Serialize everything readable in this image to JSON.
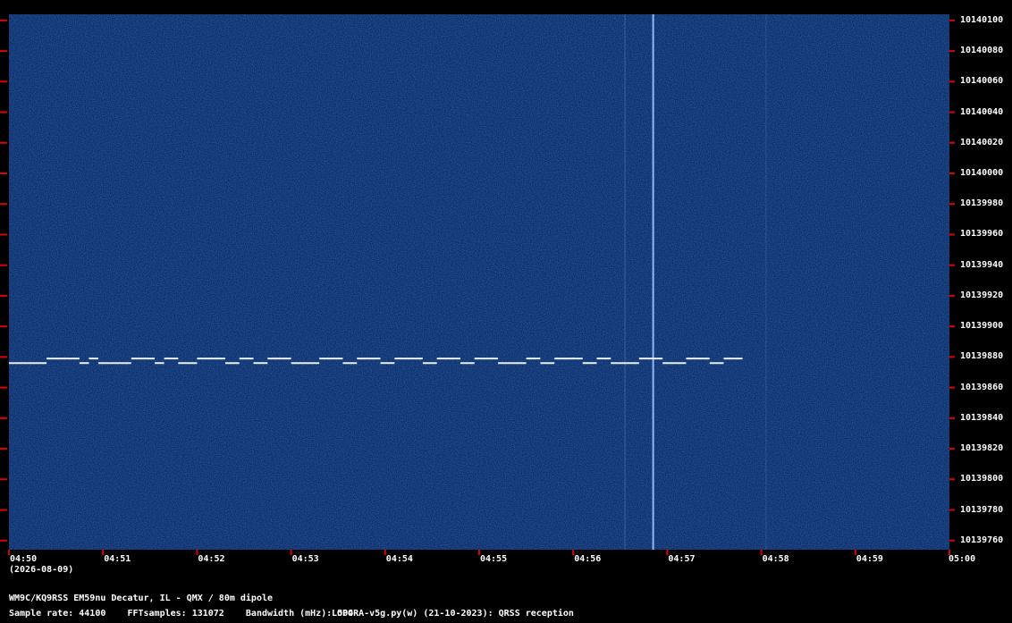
{
  "footer": {
    "date": "(2026-08-09)",
    "station": "WM9C/KQ9RSS EM59nu Decatur, IL - QMX / 80m dipole",
    "sample_info": "Sample rate: 44100    FFTsamples: 131072    Bandwidth (mHz): 504",
    "software": "LOPORA-v5g.py(w) (21-10-2023): QRSS reception"
  },
  "colors": {
    "background": "#000000",
    "plot": "#0a2766",
    "tick": "#e00000",
    "signal": "#e8f0ff"
  },
  "chart_data": {
    "type": "heatmap",
    "title": "",
    "xlabel": "",
    "ylabel": "",
    "x_ticks": [
      "04:50",
      "04:51",
      "04:52",
      "04:53",
      "04:54",
      "04:55",
      "04:56",
      "04:57",
      "04:58",
      "04:59",
      "05:00"
    ],
    "y_ticks": [
      "10140100",
      "10140080",
      "10140060",
      "10140040",
      "10140020",
      "10140000",
      "10139980",
      "10139960",
      "10139940",
      "10139920",
      "10139900",
      "10139880",
      "10139860",
      "10139840",
      "10139820",
      "10139800",
      "10139780",
      "10139760"
    ],
    "y_range": [
      10139754,
      10140104
    ],
    "x_range_minutes": [
      0,
      10
    ],
    "signal": {
      "base_freq": 10139876,
      "high_freq": 10139879,
      "segments": [
        [
          0.0,
          0.4,
          0
        ],
        [
          0.4,
          0.75,
          1
        ],
        [
          0.75,
          0.85,
          0
        ],
        [
          0.85,
          0.95,
          1
        ],
        [
          0.95,
          1.3,
          0
        ],
        [
          1.3,
          1.55,
          1
        ],
        [
          1.55,
          1.65,
          0
        ],
        [
          1.65,
          1.8,
          1
        ],
        [
          1.8,
          2.0,
          0
        ],
        [
          2.0,
          2.3,
          1
        ],
        [
          2.3,
          2.45,
          0
        ],
        [
          2.45,
          2.6,
          1
        ],
        [
          2.6,
          2.75,
          0
        ],
        [
          2.75,
          3.0,
          1
        ],
        [
          3.0,
          3.3,
          0
        ],
        [
          3.3,
          3.55,
          1
        ],
        [
          3.55,
          3.7,
          0
        ],
        [
          3.7,
          3.95,
          1
        ],
        [
          3.95,
          4.1,
          0
        ],
        [
          4.1,
          4.4,
          1
        ],
        [
          4.4,
          4.55,
          0
        ],
        [
          4.55,
          4.8,
          1
        ],
        [
          4.8,
          4.95,
          0
        ],
        [
          4.95,
          5.2,
          1
        ],
        [
          5.2,
          5.5,
          0
        ],
        [
          5.5,
          5.65,
          1
        ],
        [
          5.65,
          5.8,
          0
        ],
        [
          5.8,
          6.1,
          1
        ],
        [
          6.1,
          6.25,
          0
        ],
        [
          6.25,
          6.4,
          1
        ],
        [
          6.4,
          6.7,
          0
        ],
        [
          6.7,
          6.95,
          1
        ],
        [
          6.95,
          7.2,
          0
        ],
        [
          7.2,
          7.45,
          1
        ],
        [
          7.45,
          7.6,
          0
        ],
        [
          7.6,
          7.8,
          1
        ],
        [
          7.8,
          7.8,
          0
        ]
      ],
      "end_minutes": 7.8
    },
    "vertical_lines": [
      {
        "minute": 6.85,
        "intensity": 0.85,
        "name": "carrier-burst"
      },
      {
        "minute": 6.55,
        "intensity": 0.25,
        "name": "faint-line-1"
      },
      {
        "minute": 8.05,
        "intensity": 0.15,
        "name": "faint-line-2"
      }
    ]
  }
}
